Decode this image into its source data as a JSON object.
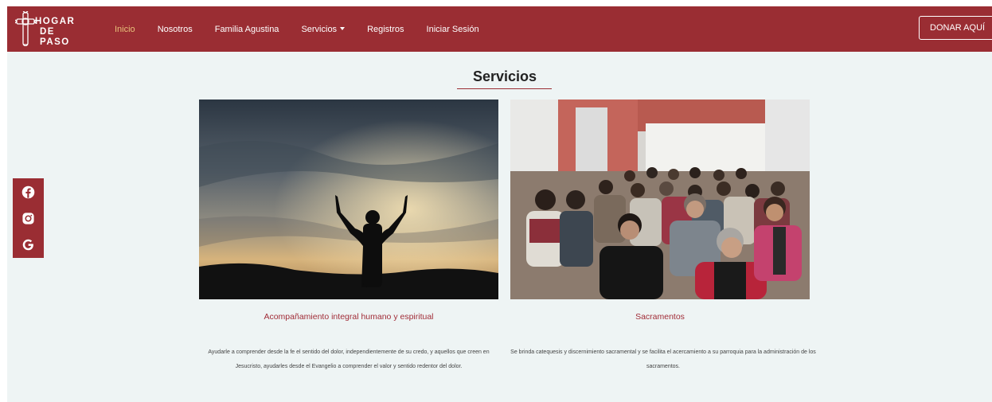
{
  "nav": {
    "logo": {
      "line1": "HOGAR",
      "line2": "DE PASO",
      "icon": "cross-logo-icon"
    },
    "links": [
      {
        "label": "Inicio",
        "active": true
      },
      {
        "label": "Nosotros",
        "active": false
      },
      {
        "label": "Familia Agustina",
        "active": false
      },
      {
        "label": "Servicios",
        "active": false,
        "dropdown": true
      },
      {
        "label": "Registros",
        "active": false
      },
      {
        "label": "Iniciar Sesión",
        "active": false
      }
    ],
    "donate_label": "DONAR AQUÍ"
  },
  "social": [
    {
      "icon": "facebook-icon"
    },
    {
      "icon": "instagram-icon"
    },
    {
      "icon": "google-icon"
    }
  ],
  "section": {
    "title": "Servicios"
  },
  "services": [
    {
      "image": "silhouette-raised-arms-sunset-photo",
      "title": "Acompañamiento integral humano y espiritual",
      "text": "Ayudarle a comprender desde la fe el sentido del dolor, independientemente de su credo, y aquellos que creen en Jesucristo, ayudarles desde el Evangelio a comprender el valor y sentido redentor del dolor."
    },
    {
      "image": "seated-congregation-photo",
      "title": "Sacramentos",
      "text": "Se brinda catequesis y discernimiento sacramental y se facilita el acercamiento a su parroquia para la administración de los sacramentos."
    }
  ],
  "colors": {
    "brand": "#9a2d33",
    "accent": "#e8c07a",
    "background": "#eef4f4",
    "card_title": "#a12d38"
  }
}
